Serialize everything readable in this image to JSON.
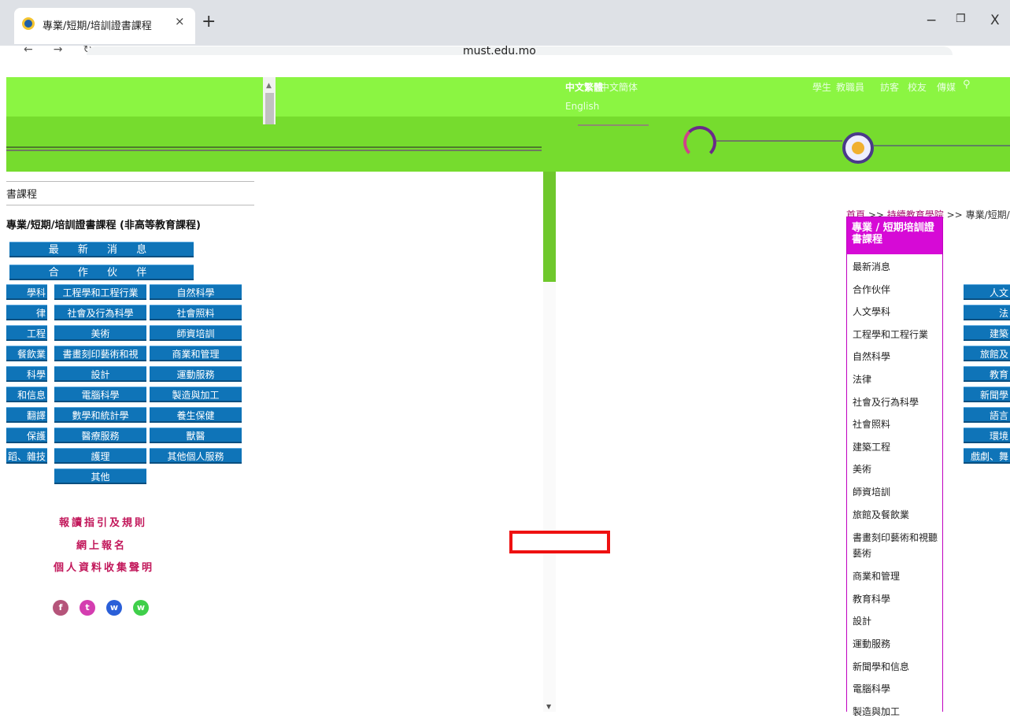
{
  "browser": {
    "tab_title": "專業/短期/培訓證書課程",
    "tab_close": "×",
    "new_tab": "+",
    "url": "must.edu.mo",
    "minimize": "−",
    "restore": "❐",
    "close": "X"
  },
  "header": {
    "lang_trad": "中文繁體",
    "lang_simp": "中文簡体",
    "lang_en": "English",
    "top_links": [
      "學生",
      "教職員",
      "訪客",
      "校友",
      "傳媒"
    ],
    "search_icon": "search-icon"
  },
  "left_panel": {
    "breadcrumb_tail": "書課程",
    "title": "專業/短期/培訓證書課程 (非高等教育課程)",
    "wide_buttons": [
      "最 新 消 息",
      "合 作 伙 伴"
    ],
    "grid": [
      [
        "學科",
        "工程學和工程行業",
        "自然科學"
      ],
      [
        "律",
        "社會及行為科學",
        "社會照料"
      ],
      [
        "工程",
        "美術",
        "師資培訓"
      ],
      [
        "餐飲業",
        "書畫刻印藝術和視",
        "商業和管理"
      ],
      [
        "科學",
        "設計",
        "運動服務"
      ],
      [
        "和信息",
        "電腦科學",
        "製造與加工"
      ],
      [
        "翻譯",
        "數學和統計學",
        "養生保健"
      ],
      [
        "保護",
        "醫療服務",
        "獸醫"
      ],
      [
        "蹈、雜技",
        "護理",
        "其他個人服務"
      ]
    ],
    "other_button": "其他",
    "links": [
      "報讀指引及規則",
      "網上報名",
      "個人資料收集聲明"
    ],
    "social": [
      {
        "name": "facebook-icon",
        "glyph": "f",
        "color": "#b5547a"
      },
      {
        "name": "twitter-icon",
        "glyph": "t",
        "color": "#d43db0"
      },
      {
        "name": "wechat-icon",
        "glyph": "w",
        "color": "#2a5fd8"
      },
      {
        "name": "weibo-icon",
        "glyph": "w",
        "color": "#3fcf4a"
      }
    ]
  },
  "right_panel": {
    "breadcrumb": {
      "home": "首頁",
      "sep": ">>",
      "level2": "持續教育學院",
      "current": "專業/短期/培訓證"
    },
    "menu_title": "專業 / 短期培訓證書課程",
    "menu_items": [
      "最新消息",
      "合作伙伴",
      "人文學科",
      "工程學和工程行業",
      "自然科學",
      "法律",
      "社會及行為科學",
      "社會照料",
      "建築工程",
      "美術",
      "師資培訓",
      "旅館及餐飲業",
      "書畫刻印藝術和視聽藝術",
      "商業和管理",
      "教育科學",
      "設計",
      "運動服務",
      "新聞學和信息",
      "電腦科學",
      "製造與加工"
    ],
    "side_buttons": [
      "人文",
      "法",
      "建築",
      "旅館及",
      "教育",
      "新聞學",
      "語言",
      "環境",
      "戲劇、舞"
    ]
  }
}
